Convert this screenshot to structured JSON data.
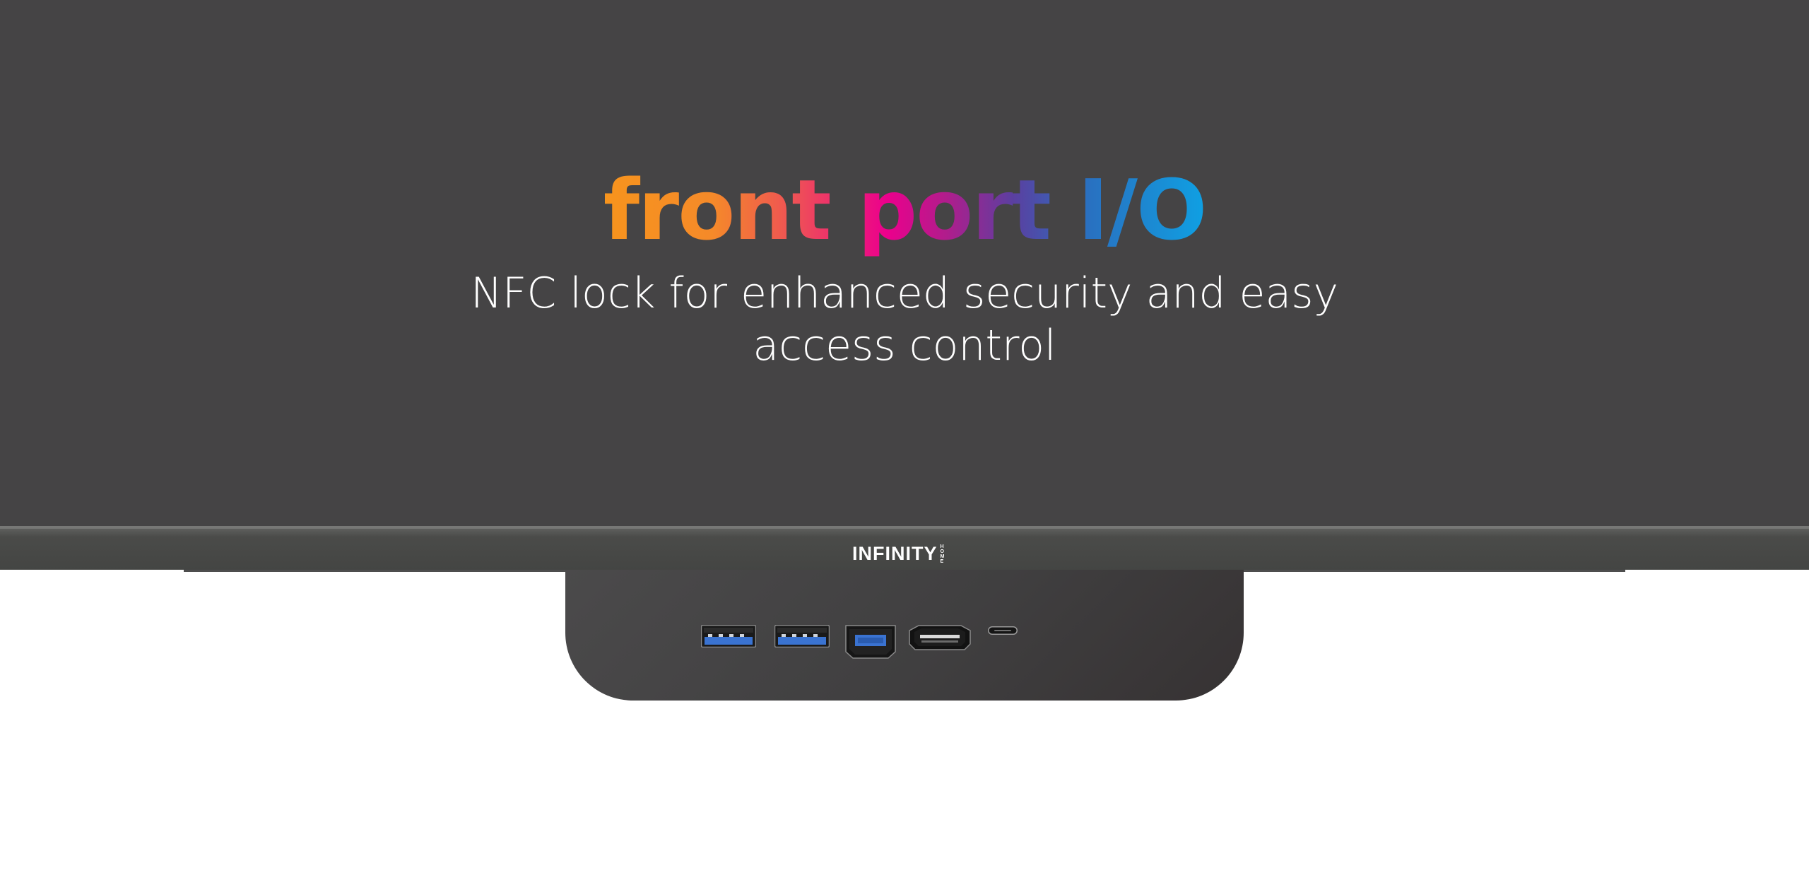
{
  "hero": {
    "title": "front port I/O",
    "subtitle": "NFC lock for enhanced security and easy access control"
  },
  "monitor": {
    "brand": "INFINITY",
    "brand_suffix": "HOME"
  },
  "ports": [
    {
      "name": "usb-a-port-1",
      "type": "usb-a"
    },
    {
      "name": "usb-a-port-2",
      "type": "usb-a"
    },
    {
      "name": "displayport",
      "type": "displayport"
    },
    {
      "name": "hdmi-port",
      "type": "hdmi"
    },
    {
      "name": "usb-c-port",
      "type": "usb-c"
    }
  ],
  "colors": {
    "screen": "#454445",
    "usb_blue": "#3a73d1",
    "gradient_start": "#f7941d",
    "gradient_mid": "#ec008c",
    "gradient_end": "#0fa0e3"
  }
}
